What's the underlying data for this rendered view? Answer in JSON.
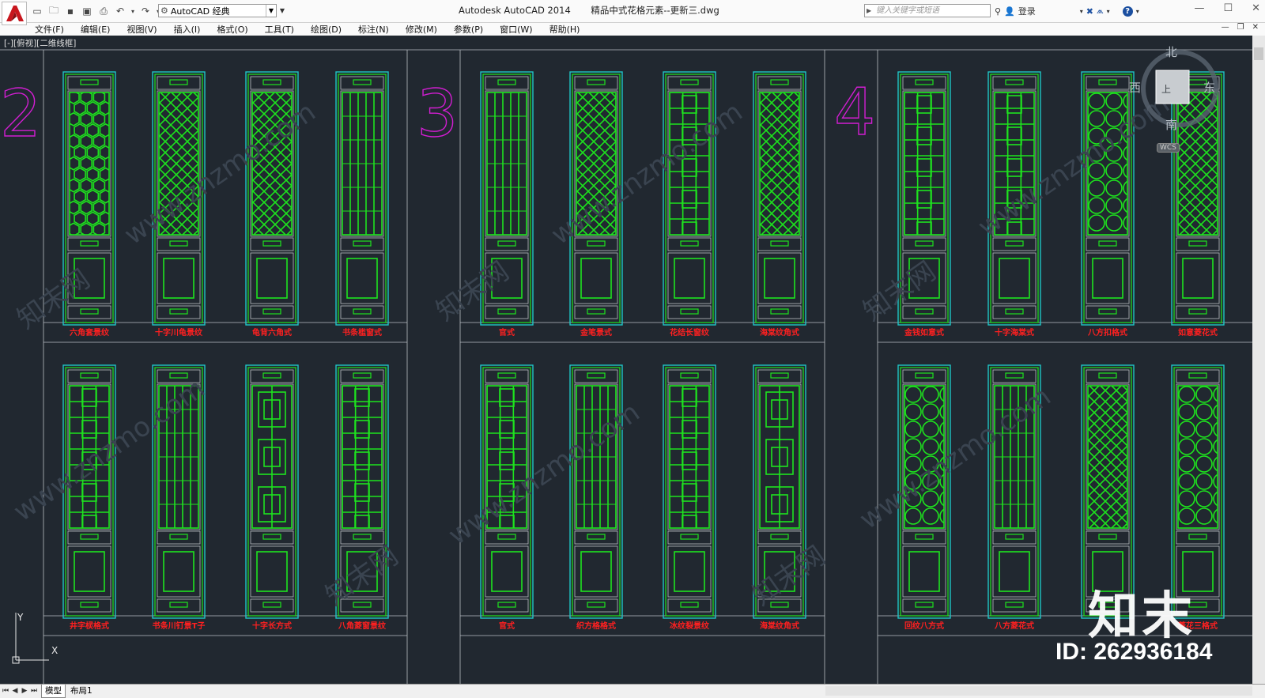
{
  "app": {
    "window_title": "Autodesk AutoCAD 2014       精品中式花格元素--更新三.dwg",
    "workspace": "AutoCAD 经典",
    "search_placeholder": "键入关键字或短语",
    "login": "登录",
    "help": "?"
  },
  "menu": [
    "文件(F)",
    "编辑(E)",
    "视图(V)",
    "插入(I)",
    "格式(O)",
    "工具(T)",
    "绘图(D)",
    "标注(N)",
    "修改(M)",
    "参数(P)",
    "窗口(W)",
    "帮助(H)"
  ],
  "viewport_label": "[-][俯视][二维线框]",
  "viewcube": {
    "north": "北",
    "south": "南",
    "west": "西",
    "east": "东",
    "wcs": "WCS"
  },
  "ucs": {
    "x": "X",
    "y": "Y"
  },
  "tabs": {
    "model": "模型",
    "layout1": "布局1"
  },
  "watermark": {
    "site": "www.znzmo.com",
    "brand": "知末网",
    "logo": "知末",
    "id": "ID: 262936184"
  },
  "group_numbers": [
    "2",
    "3",
    "4"
  ],
  "colors": {
    "panel": "#1ee31e",
    "frame": "#1fc6c6",
    "label": "#ff2020",
    "number": "#d21ed2",
    "background": "#212830"
  },
  "drawing_labels": {
    "group2_top": [
      "六角套景纹",
      "十字川龟景纹",
      "龟背六角式",
      "书条槛窗式"
    ],
    "group2_bottom": [
      "井字棂格式",
      "书条川钉景T子",
      "十字长方式",
      "八角菱窗景纹"
    ],
    "group3_top": [
      "官式",
      "金笔景式",
      "花结长窗纹",
      "海棠纹角式"
    ],
    "group3_bottom": [
      "官式",
      "织方格格式",
      "冰纹裂景纹",
      "海棠纹角式"
    ],
    "group4_top": [
      "金钱如意式",
      "十字海棠式",
      "八方扣格式",
      "如意菱花式"
    ],
    "group4_bottom": [
      "回纹八方式",
      "八方菱花式",
      "",
      "菱花三格式"
    ]
  }
}
